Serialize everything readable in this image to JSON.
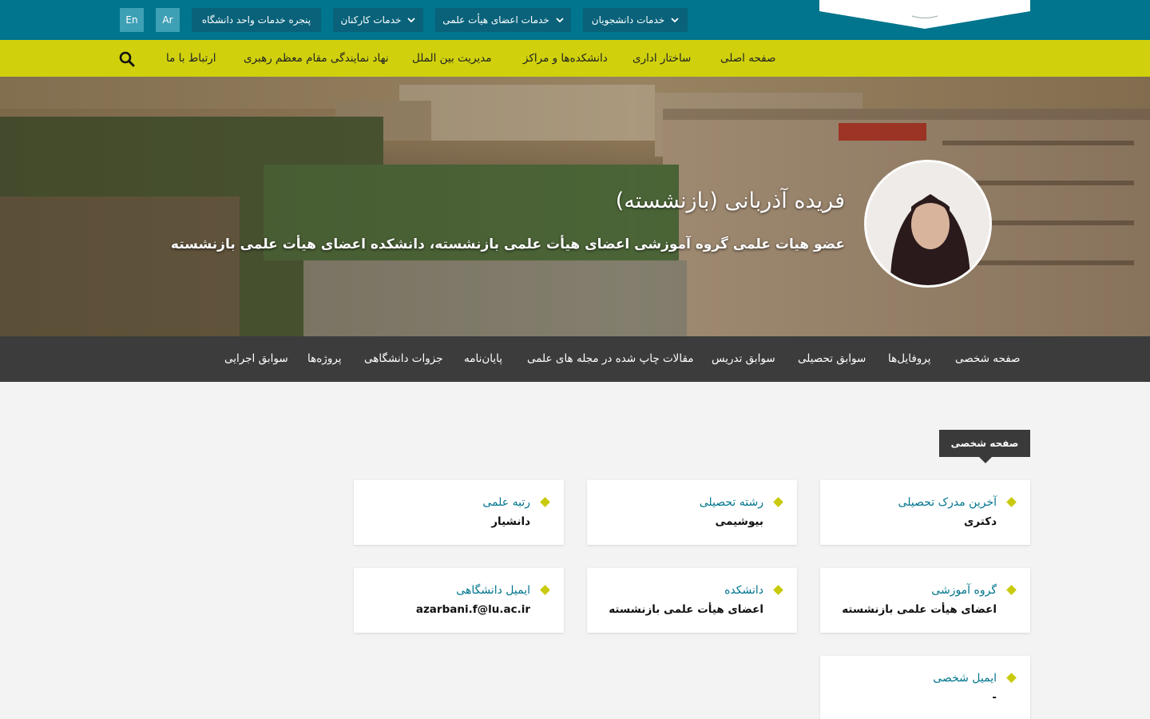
{
  "topbar": {
    "menus": [
      {
        "label": "خدمات دانشجویان"
      },
      {
        "label": "خدمات اعضای هیأت علمی"
      },
      {
        "label": "خدمات کارکنان"
      }
    ],
    "services_window": "پنجره خدمات واحد دانشگاه",
    "lang_ar": "Ar",
    "lang_en": "En"
  },
  "mainnav": {
    "items": [
      {
        "label": "صفحه اصلی"
      },
      {
        "label": "ساختار اداری"
      },
      {
        "label": "دانشکده‌ها و مراکز"
      },
      {
        "label": "مدیریت بین الملل"
      },
      {
        "label": "نهاد نمایندگی مقام معظم رهبری"
      },
      {
        "label": "ارتباط با ما"
      }
    ],
    "search_icon": "search-icon"
  },
  "profile": {
    "name": "فریده آذربانی (بازنشسته)",
    "subtitle": "عضو هیات علمی گروه آموزشی اعضای هیأت علمی بازنشسته، دانشکده اعضای هیأت علمی بازنشسته"
  },
  "tabs": [
    {
      "label": "صفحه شخصی"
    },
    {
      "label": "پروفایل‌ها"
    },
    {
      "label": "سوابق تحصیلی"
    },
    {
      "label": "سوابق تدریس"
    },
    {
      "label": "مقالات چاپ شده در مجله های علمی"
    },
    {
      "label": "پایان‌نامه"
    },
    {
      "label": "جزوات دانشگاهی"
    },
    {
      "label": "پروژه‌ها"
    },
    {
      "label": "سوابق اجرایی"
    }
  ],
  "section_label": "صفحه شخصی",
  "cards": [
    {
      "label": "آخرین مدرک تحصیلی",
      "value": "دکتری"
    },
    {
      "label": "رشته تحصیلی",
      "value": "بیوشیمی"
    },
    {
      "label": "رتبه علمی",
      "value": "دانشیار"
    },
    {
      "label": "گروه آموزشی",
      "value": "اعضای هیأت علمی بازنشسته"
    },
    {
      "label": "دانشکده",
      "value": "اعضای هیأت علمی بازنشسته"
    },
    {
      "label": "ایمیل دانشگاهی",
      "value": "azarbani.f@lu.ac.ir"
    },
    {
      "label": "ایمیل شخصی",
      "value": "-"
    }
  ],
  "colors": {
    "topbar": "#00758d",
    "mainnav": "#d0d10c",
    "tabs_bar": "#3c3c3c",
    "accent_label": "#00758d",
    "diamond": "#c9ca0b"
  }
}
